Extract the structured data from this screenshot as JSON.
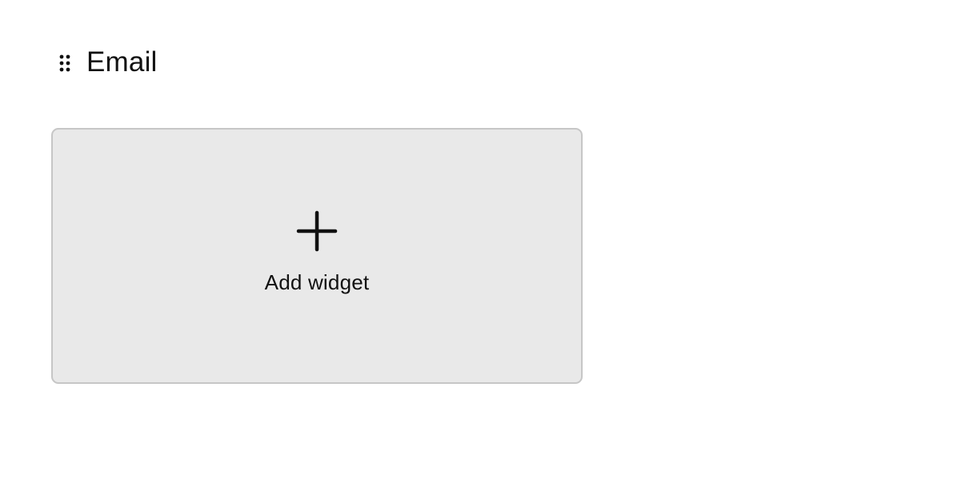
{
  "section": {
    "title": "Email",
    "drag_handle_icon": "drag-handle-icon"
  },
  "add_widget": {
    "label": "Add widget",
    "icon": "plus-icon"
  },
  "colors": {
    "card_background": "#e9e9e9",
    "card_border": "#c6c6c6",
    "text": "#111111",
    "page_background": "#ffffff"
  }
}
